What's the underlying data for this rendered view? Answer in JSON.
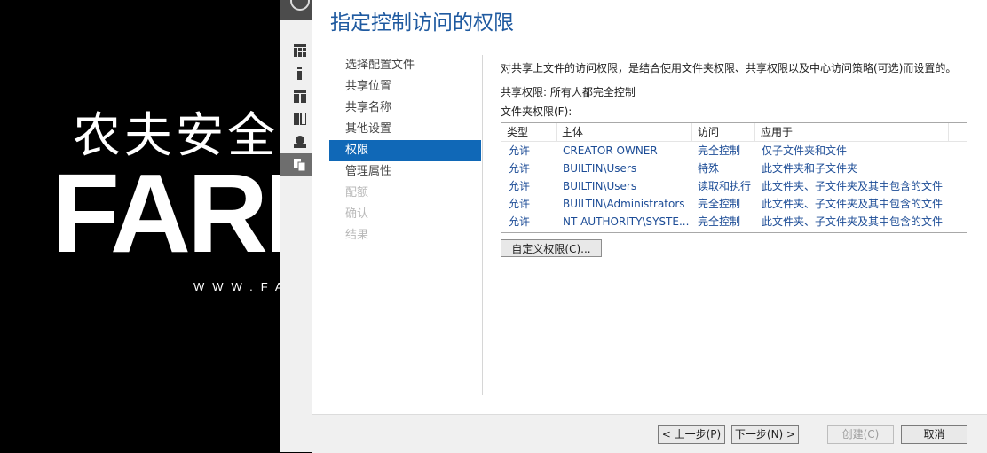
{
  "wallpaper": {
    "text_cn": "农夫安全",
    "text_en": "FARM",
    "url": "WWW.FA"
  },
  "server_manager": {
    "icons": [
      "dashboard-icon",
      "local-server-icon",
      "all-servers-icon",
      "file-storage-icon",
      "iis-icon",
      "shares-icon"
    ]
  },
  "wizard": {
    "title": "指定控制访问的权限",
    "steps": [
      {
        "label": "选择配置文件",
        "state": "normal"
      },
      {
        "label": "共享位置",
        "state": "normal"
      },
      {
        "label": "共享名称",
        "state": "normal"
      },
      {
        "label": "其他设置",
        "state": "normal"
      },
      {
        "label": "权限",
        "state": "active"
      },
      {
        "label": "管理属性",
        "state": "normal"
      },
      {
        "label": "配额",
        "state": "disabled"
      },
      {
        "label": "确认",
        "state": "disabled"
      },
      {
        "label": "结果",
        "state": "disabled"
      }
    ],
    "description": "对共享上文件的访问权限，是结合使用文件夹权限、共享权限以及中心访问策略(可选)而设置的。",
    "share_permissions": "共享权限: 所有人都完全控制",
    "folder_permissions_label": "文件夹权限(F):",
    "table": {
      "columns": [
        "类型",
        "主体",
        "访问",
        "应用于"
      ],
      "rows": [
        [
          "允许",
          "CREATOR OWNER",
          "完全控制",
          "仅子文件夹和文件"
        ],
        [
          "允许",
          "BUILTIN\\Users",
          "特殊",
          "此文件夹和子文件夹"
        ],
        [
          "允许",
          "BUILTIN\\Users",
          "读取和执行",
          "此文件夹、子文件夹及其中包含的文件"
        ],
        [
          "允许",
          "BUILTIN\\Administrators",
          "完全控制",
          "此文件夹、子文件夹及其中包含的文件"
        ],
        [
          "允许",
          "NT AUTHORITY\\SYSTE...",
          "完全控制",
          "此文件夹、子文件夹及其中包含的文件"
        ]
      ]
    },
    "custom_permissions_button": "自定义权限(C)...",
    "buttons": {
      "previous": "< 上一步(P)",
      "next": "下一步(N) >",
      "create": "创建(C)",
      "cancel": "取消"
    }
  },
  "colors": {
    "title_blue": "#1f5aa0",
    "active_step": "#1068b7",
    "table_text": "#1c4c96"
  }
}
